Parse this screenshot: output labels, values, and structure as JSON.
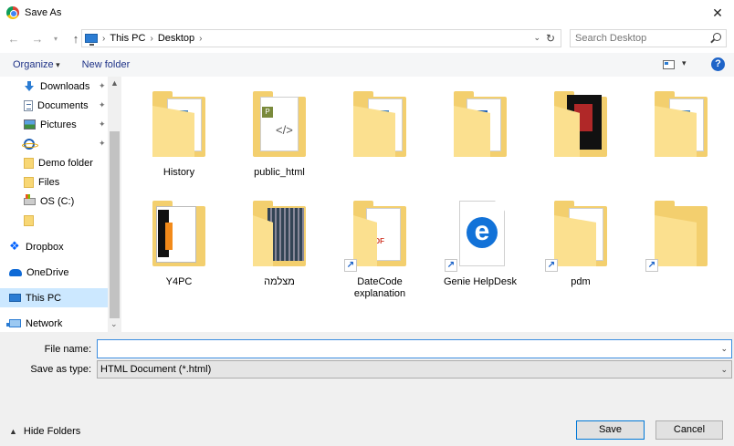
{
  "window": {
    "title": "Save As",
    "close_glyph": "✕"
  },
  "nav": {
    "back_glyph": "←",
    "forward_glyph": "→",
    "recent_glyph": "▾",
    "up_glyph": "↑",
    "breadcrumbs": [
      "This PC",
      "Desktop"
    ],
    "sep_glyph": "›",
    "addr_drop_glyph": "⌄",
    "refresh_glyph": "↻",
    "search_placeholder": "Search Desktop"
  },
  "toolbar": {
    "organize": "Organize",
    "new_folder": "New folder",
    "view_drop_glyph": "▾",
    "help": "?"
  },
  "sidebar": {
    "items": [
      {
        "label": "Downloads",
        "pinned": true
      },
      {
        "label": "Documents",
        "pinned": true
      },
      {
        "label": "Pictures",
        "pinned": true
      },
      {
        "label": "",
        "pinned": true
      },
      {
        "label": "Demo folder",
        "pinned": false
      },
      {
        "label": "Files",
        "pinned": false
      },
      {
        "label": "OS (C:)",
        "pinned": false
      },
      {
        "label": "",
        "pinned": false
      },
      {
        "label": "Dropbox",
        "pinned": false
      },
      {
        "label": "OneDrive",
        "pinned": false
      },
      {
        "label": "This PC",
        "pinned": false
      },
      {
        "label": "Network",
        "pinned": false
      }
    ],
    "pin_glyph": "✦",
    "scroll_up": "▲",
    "scroll_down": "⌄"
  },
  "files": [
    {
      "name": "History",
      "line2": ""
    },
    {
      "name": "public_html",
      "line2": ""
    },
    {
      "name": "",
      "line2": ""
    },
    {
      "name": "",
      "line2": ""
    },
    {
      "name": "",
      "line2": ""
    },
    {
      "name": "",
      "line2": ""
    },
    {
      "name": "Y4PC",
      "line2": ""
    },
    {
      "name": "מצלמה",
      "line2": ""
    },
    {
      "name": "DateCode",
      "line2": "explanation"
    },
    {
      "name": "Genie HelpDesk",
      "line2": ""
    },
    {
      "name": "pdm",
      "line2": ""
    },
    {
      "name": "",
      "line2": ""
    }
  ],
  "shortcut_glyph": "↗",
  "php_badge": "P",
  "php_code": "</>",
  "pdf_text": "PDF",
  "edge_letter": "e",
  "bottom": {
    "file_name_label": "File name:",
    "file_name_value": "",
    "save_type_label": "Save as type:",
    "save_type_value": "HTML Document (*.html)",
    "dropdown_glyph": "⌄",
    "hide_folders": "Hide Folders",
    "hide_chev": "▲",
    "save": "Save",
    "cancel": "Cancel"
  },
  "colors": {
    "accent": "#0078d7",
    "selected": "#cce8ff",
    "folder": "#f3cf6e"
  }
}
